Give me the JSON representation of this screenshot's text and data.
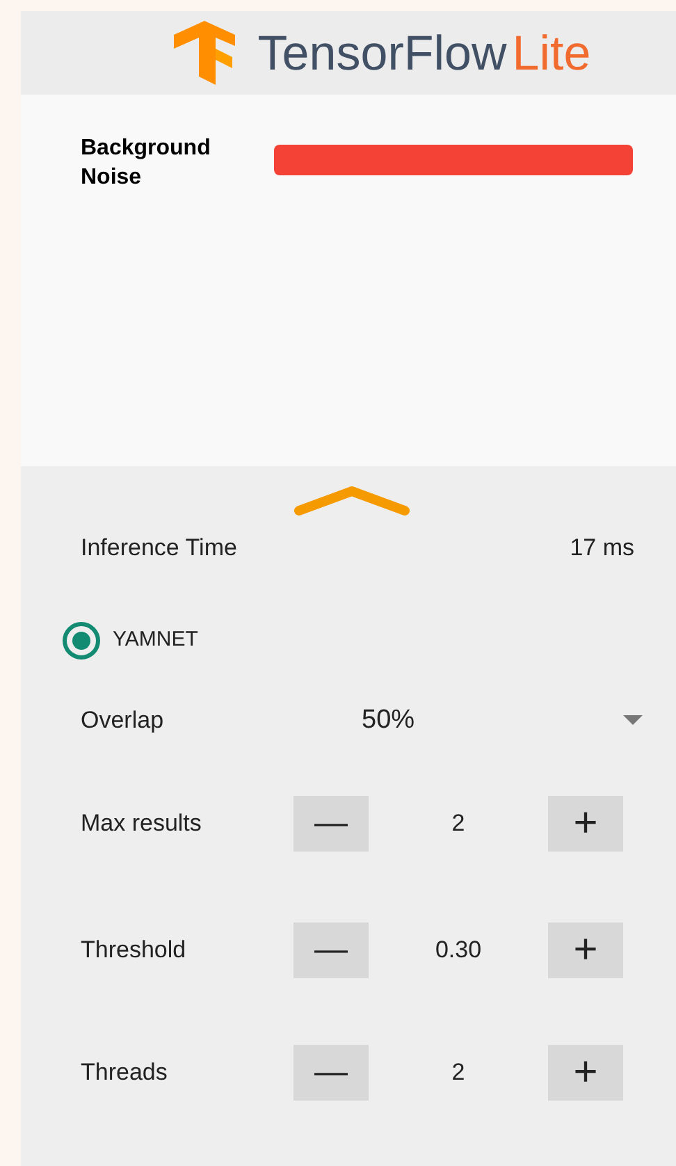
{
  "header": {
    "logo_text": "TensorFlow",
    "logo_suffix": "Lite"
  },
  "results": [
    {
      "label": "Background Noise",
      "color": "#f44336"
    }
  ],
  "inference": {
    "label": "Inference Time",
    "value": "17 ms"
  },
  "models": [
    {
      "label": "YAMNET",
      "selected": true
    }
  ],
  "overlap": {
    "label": "Overlap",
    "value": "50%"
  },
  "steppers": [
    {
      "label": "Max results",
      "value": "2",
      "minus": "—",
      "plus": "+"
    },
    {
      "label": "Threshold",
      "value": "0.30",
      "minus": "—",
      "plus": "+"
    },
    {
      "label": "Threads",
      "value": "2",
      "minus": "—",
      "plus": "+"
    }
  ]
}
